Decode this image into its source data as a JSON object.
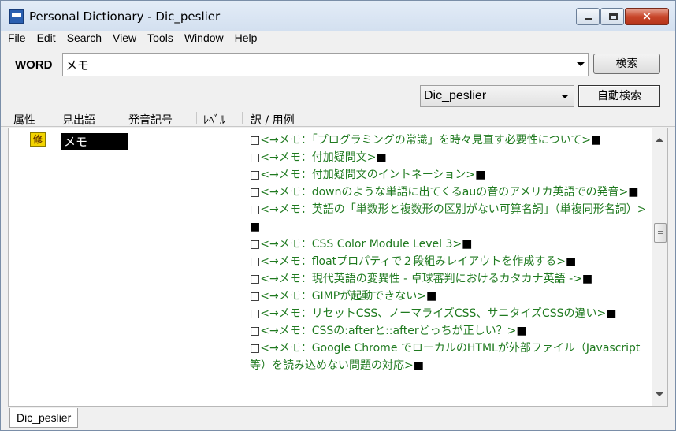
{
  "window": {
    "title": "Personal Dictionary - Dic_peslier",
    "close_glyph": "✕"
  },
  "menu": [
    "File",
    "Edit",
    "Search",
    "View",
    "Tools",
    "Window",
    "Help"
  ],
  "word": {
    "label": "WORD",
    "value": "メモ",
    "search_button": "検索"
  },
  "toolbar": {
    "dictionary": "Dic_peslier",
    "auto_search_button": "自動検索"
  },
  "columns": {
    "attribute": "属性",
    "headword": "見出語",
    "pronunciation": "発音記号",
    "level": "ﾚﾍﾞﾙ",
    "translation": "訳 / 用例"
  },
  "result": {
    "attribute_badge": "修",
    "headword": "メモ",
    "entry_prefix": "□",
    "entry_suffix": "■",
    "entries": [
      "<→メモ：「プログラミングの常識」を時々見直す必要性について>",
      "<→メモ：付加疑問文>",
      "<→メモ：付加疑問文のイントネーション>",
      "<→メモ：downのような単語に出てくるauの音のアメリカ英語での発音>",
      "<→メモ：英語の「単数形と複数形の区別がない可算名詞」（単複同形名詞）>",
      "<→メモ：CSS Color Module Level 3>",
      "<→メモ：floatプロパティで２段組みレイアウトを作成する>",
      "<→メモ：現代英語の変異性 - 卓球審判におけるカタカナ英語 ->",
      "<→メモ：GIMPが起動できない>",
      "<→メモ：リセットCSS、ノーマライズCSS、サニタイズCSSの違い>",
      "<→メモ：CSSの:afterと::afterどっちが正しい？>",
      "<→メモ：Google Chrome でローカルのHTMLが外部ファイル（Javascript等）を読み込めない問題の対応>"
    ]
  },
  "status": {
    "tab": "Dic_peslier"
  },
  "colors": {
    "entry_text": "#1f7a1f",
    "badge_fill": "#f3d400",
    "close_button": "#c8462a"
  }
}
